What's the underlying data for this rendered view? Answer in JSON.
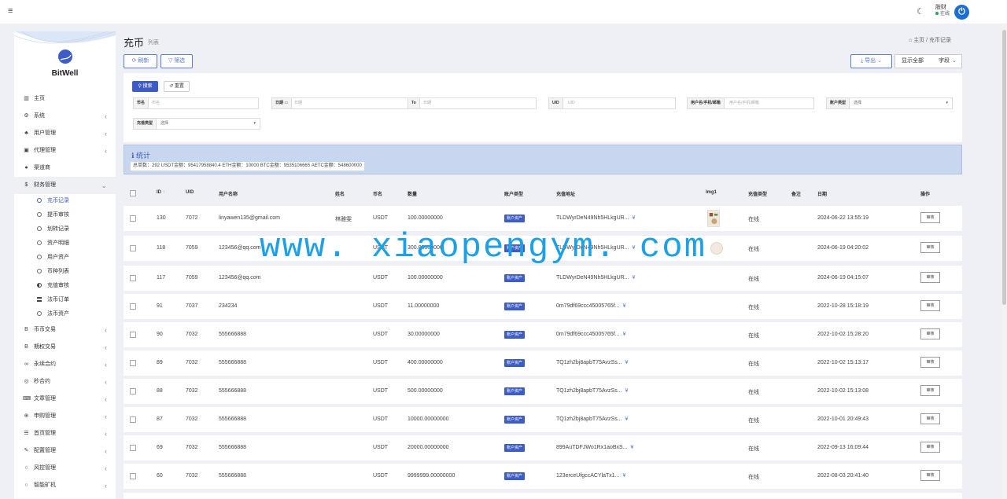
{
  "topbar": {
    "menu_icon": "hamburger-icon",
    "theme_icon": "moon-icon",
    "user_name": "肢财",
    "user_status": "在线",
    "avatar_icon": "power-icon"
  },
  "sidebar": {
    "logo_text": "BitWell",
    "items": [
      {
        "label": "主页",
        "icon": "bar-chart-icon",
        "has_arrow": false
      },
      {
        "label": "系统",
        "icon": "gear-icon",
        "has_arrow": true
      },
      {
        "label": "用户管理",
        "icon": "users-icon",
        "has_arrow": true
      },
      {
        "label": "代理管理",
        "icon": "id-card-icon",
        "has_arrow": true
      },
      {
        "label": "渠道商",
        "icon": "user-circle-icon",
        "has_arrow": false
      },
      {
        "label": "财务管理",
        "icon": "dollar-icon",
        "has_arrow": true,
        "open": true
      }
    ],
    "sub_items": [
      {
        "label": "充币记录",
        "icon": "circle",
        "active": true
      },
      {
        "label": "提币审核",
        "icon": "circle"
      },
      {
        "label": "划转记录",
        "icon": "circle"
      },
      {
        "label": "资产明细",
        "icon": "circle"
      },
      {
        "label": "用户资产",
        "icon": "circle"
      },
      {
        "label": "币种列表",
        "icon": "circle"
      },
      {
        "label": "充值审核",
        "icon": "half"
      },
      {
        "label": "法币订单",
        "icon": "lines"
      },
      {
        "label": "法币资产",
        "icon": "circle"
      }
    ],
    "items_after": [
      {
        "label": "币币交易",
        "icon": "bitcoin-icon"
      },
      {
        "label": "期权交易",
        "icon": "bitcoin-icon"
      },
      {
        "label": "永续合约",
        "icon": "link-icon"
      },
      {
        "label": "秒合约",
        "icon": "target-icon"
      },
      {
        "label": "文章管理",
        "icon": "keyboard-icon"
      },
      {
        "label": "申购管理",
        "icon": "lifebuoy-icon"
      },
      {
        "label": "首页管理",
        "icon": "list-icon"
      },
      {
        "label": "配置管理",
        "icon": "wrench-icon"
      },
      {
        "label": "风控管理",
        "icon": "circle-icon"
      },
      {
        "label": "智能矿机",
        "icon": "circle-icon"
      }
    ]
  },
  "header": {
    "title": "充币",
    "subtitle": "列表",
    "breadcrumb_home": "主页",
    "breadcrumb_sep": "/",
    "breadcrumb_current": "充币记录"
  },
  "toolbar": {
    "refresh_label": "刷新",
    "filter_label": "筛选",
    "export_label": "导出",
    "show_all_label": "显示全部",
    "fields_label": "字段"
  },
  "search": {
    "search_label": "搜索",
    "reset_label": "重置",
    "coin_label": "币名",
    "coin_placeholder": "币名",
    "date_label": "日期",
    "date_placeholder": "日期",
    "to_label": "To",
    "date_to_placeholder": "日期",
    "uid_label": "UID",
    "uid_placeholder": "UID",
    "user_label": "用户名/手机/邮箱",
    "user_placeholder": "用户名/手机/邮箱",
    "account_type_label": "账户类型",
    "account_type_value": "选择",
    "recharge_type_label": "充值类型",
    "recharge_type_value": "选择"
  },
  "stats": {
    "title": "统计",
    "line": "总单数：292   USDT金额：95417958840.4   ETH金额：10000   BTC金额：9535106665   AETC金额：548600000"
  },
  "table": {
    "columns": [
      "ID",
      "UID",
      "用户名称",
      "姓名",
      "币名",
      "数量",
      "账户类型",
      "充值地址",
      "Img1",
      "充值类型",
      "备注",
      "日期",
      "操作"
    ],
    "sort_icon": "↑",
    "rows": [
      {
        "id": "130",
        "uid": "7072",
        "username": "linyawen135@gmail.com",
        "name": "林雅雯",
        "coin": "USDT",
        "amount": "100.00000000",
        "account_type": "账户资产",
        "address": "TLDWyrDeN49Nh5HLkgUR...",
        "img": "photo",
        "recharge_type": "在线",
        "date": "2024-06-22 13:55:19",
        "action": "审核"
      },
      {
        "id": "118",
        "uid": "7059",
        "username": "123456@qq.com",
        "name": "",
        "coin": "USDT",
        "amount": "300.00000000",
        "account_type": "账户资产",
        "address": "TLDWyrDeN49Nh5HLkgUR...",
        "img": "round",
        "recharge_type": "在线",
        "date": "2024-06-19 04:20:02",
        "action": "审核"
      },
      {
        "id": "117",
        "uid": "7059",
        "username": "123456@qq.com",
        "name": "",
        "coin": "USDT",
        "amount": "100.00000000",
        "account_type": "账户资产",
        "address": "TLDWyrDeN49Nh5HLkgUR...",
        "img": "",
        "recharge_type": "在线",
        "date": "2024-06-19 04:15:07",
        "action": "审核"
      },
      {
        "id": "91",
        "uid": "7037",
        "username": "234234",
        "name": "",
        "coin": "USDT",
        "amount": "11.00000000",
        "account_type": "账户资产",
        "address": "0m79df69ccc45005765f...",
        "img": "",
        "recharge_type": "在线",
        "date": "2022-10-28 15:18:19",
        "action": "审核"
      },
      {
        "id": "90",
        "uid": "7032",
        "username": "555666888",
        "name": "",
        "coin": "USDT",
        "amount": "30.00000000",
        "account_type": "账户资产",
        "address": "0m79df69ccc45005765f...",
        "img": "",
        "recharge_type": "在线",
        "date": "2022-10-02 15:28:20",
        "action": "审核"
      },
      {
        "id": "89",
        "uid": "7032",
        "username": "555666888",
        "name": "",
        "coin": "USDT",
        "amount": "400.00000000",
        "account_type": "账户资产",
        "address": "TQ1zh2bj8apbT75AvzSs...",
        "img": "",
        "recharge_type": "在线",
        "date": "2022-10-02 15:13:17",
        "action": "审核"
      },
      {
        "id": "88",
        "uid": "7032",
        "username": "555666888",
        "name": "",
        "coin": "USDT",
        "amount": "500.00000000",
        "account_type": "账户资产",
        "address": "TQ1zh2bj8apbT75AvzSs...",
        "img": "",
        "recharge_type": "在线",
        "date": "2022-10-02 15:13:08",
        "action": "审核"
      },
      {
        "id": "87",
        "uid": "7032",
        "username": "555666888",
        "name": "",
        "coin": "USDT",
        "amount": "10000.00000000",
        "account_type": "账户资产",
        "address": "TQ1zh2bj8apbT75AvzSs...",
        "img": "",
        "recharge_type": "在线",
        "date": "2022-10-01 20:49:43",
        "action": "审核"
      },
      {
        "id": "69",
        "uid": "7032",
        "username": "555666888",
        "name": "",
        "coin": "USDT",
        "amount": "20000.00000000",
        "account_type": "账户资产",
        "address": "899AuTDFJWo1Rx1aoBxS...",
        "img": "",
        "recharge_type": "在线",
        "date": "2022-09-13 16:09:44",
        "action": "审核"
      },
      {
        "id": "60",
        "uid": "7032",
        "username": "555666888",
        "name": "",
        "coin": "USDT",
        "amount": "9999999.00000000",
        "account_type": "账户资产",
        "address": "123erceUfgccACYlaTx1...",
        "img": "",
        "recharge_type": "在线",
        "date": "2022-08-03 20:41:40",
        "action": "审核"
      }
    ]
  },
  "watermark": "www. xiaopengym. com",
  "colors": {
    "primary": "#3e5cc5",
    "info_bg": "#c8d6ef",
    "watermark": "#1ea0e6",
    "online": "#2aa55b",
    "avatar": "#1c6fd0"
  }
}
